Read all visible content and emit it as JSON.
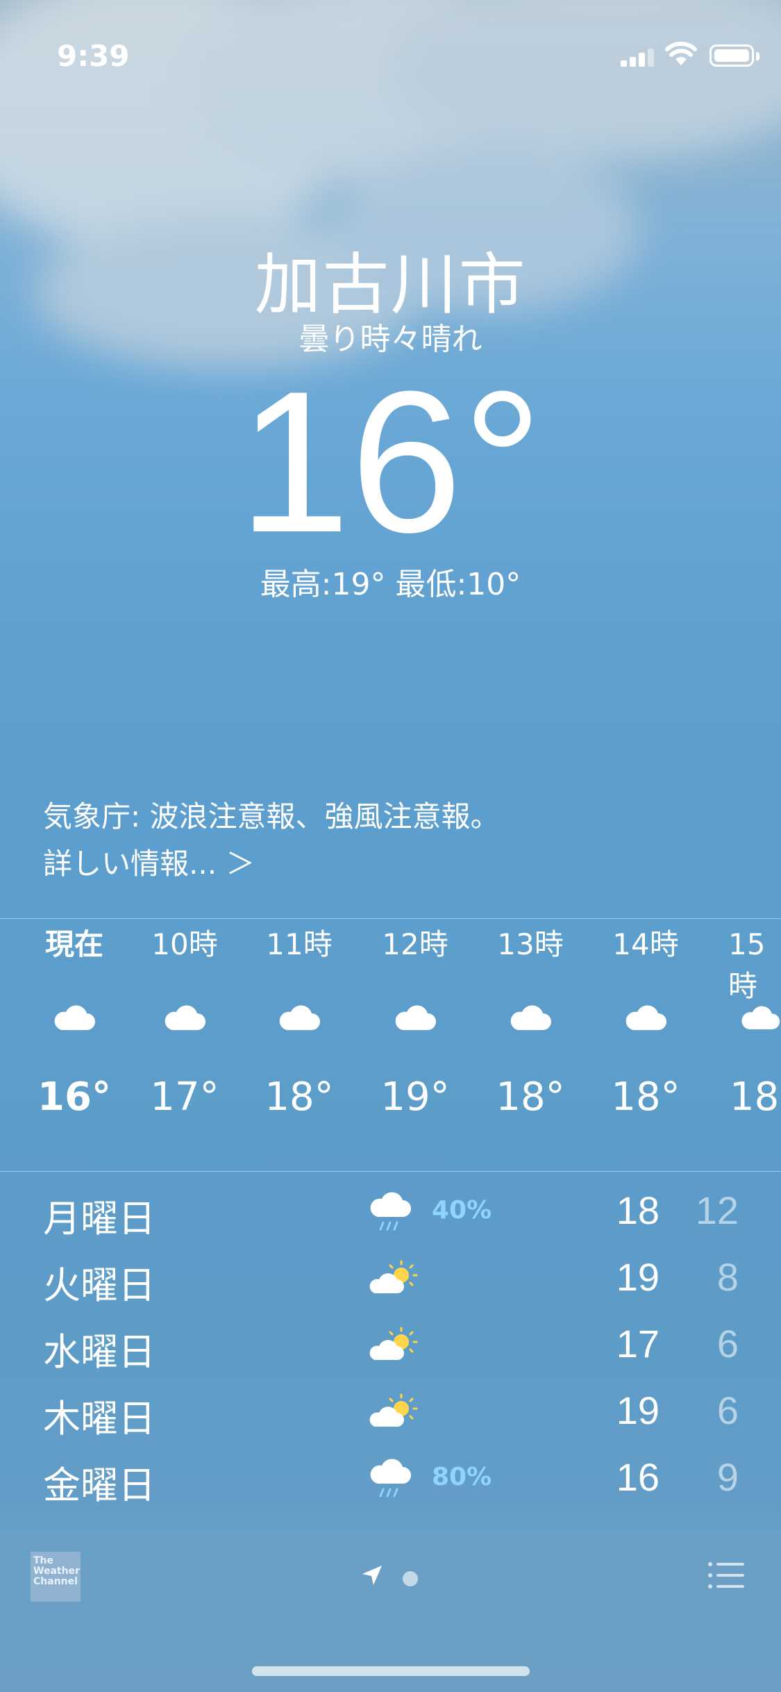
{
  "status_bar": {
    "time": "9:39"
  },
  "location": {
    "city": "加古川市",
    "condition": "曇り時々晴れ",
    "temperature": "16°",
    "hilo": "最高:19° 最低:10°"
  },
  "alert": {
    "text": "気象庁: 波浪注意報、強風注意報。",
    "link": "詳しい情報... ＞"
  },
  "hourly": [
    {
      "label": "現在",
      "icon": "cloud-icon",
      "temp": "16°"
    },
    {
      "label": "10時",
      "icon": "cloud-icon",
      "temp": "17°"
    },
    {
      "label": "11時",
      "icon": "cloud-icon",
      "temp": "18°"
    },
    {
      "label": "12時",
      "icon": "cloud-icon",
      "temp": "19°"
    },
    {
      "label": "13時",
      "icon": "cloud-icon",
      "temp": "18°"
    },
    {
      "label": "14時",
      "icon": "cloud-icon",
      "temp": "18°"
    },
    {
      "label": "15時",
      "icon": "cloud-icon",
      "temp": "18°"
    }
  ],
  "daily": [
    {
      "day": "月曜日",
      "icon": "rain-icon",
      "pop": "40%",
      "hi": "18",
      "lo": "12"
    },
    {
      "day": "火曜日",
      "icon": "partly-sunny-icon",
      "pop": "",
      "hi": "19",
      "lo": "8"
    },
    {
      "day": "水曜日",
      "icon": "partly-sunny-icon",
      "pop": "",
      "hi": "17",
      "lo": "6"
    },
    {
      "day": "木曜日",
      "icon": "partly-sunny-icon",
      "pop": "",
      "hi": "19",
      "lo": "6"
    },
    {
      "day": "金曜日",
      "icon": "rain-icon",
      "pop": "80%",
      "hi": "16",
      "lo": "9"
    }
  ],
  "bottom_bar": {
    "logo": "The Weather Channel"
  }
}
